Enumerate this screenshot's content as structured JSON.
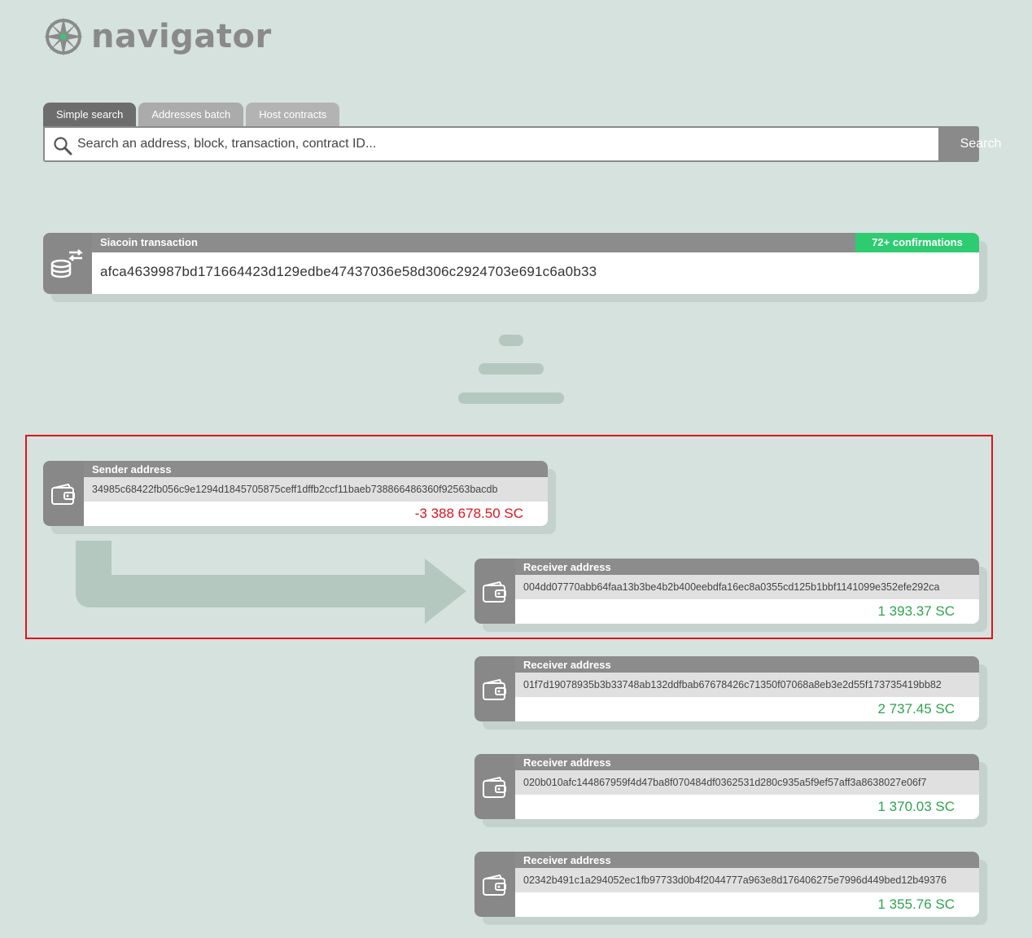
{
  "brand": {
    "name": "navigator"
  },
  "tabs": [
    {
      "label": "Simple search",
      "active": true
    },
    {
      "label": "Addresses batch",
      "active": false
    },
    {
      "label": "Host contracts",
      "active": false
    }
  ],
  "search": {
    "placeholder": "Search an address, block, transaction, contract ID...",
    "value": "",
    "button_label": "Search",
    "icon": "search-icon"
  },
  "transaction": {
    "type_label": "Siacoin transaction",
    "confirmations": "72+ confirmations",
    "hash": "afca4639987bd171664423d129edbe47437036e58d306c2924703e691c6a0b33",
    "icon": "coins-exchange-icon"
  },
  "sender": {
    "title": "Sender address",
    "address": "34985c68422fb056c9e1294d1845705875ceff1dffb2ccf11baeb738866486360f92563bacdb",
    "amount": "-3 388 678.50 SC",
    "icon": "wallet-icon"
  },
  "receivers": [
    {
      "title": "Receiver address",
      "address": "004dd07770abb64faa13b3be4b2b400eebdfa16ec8a0355cd125b1bbf1141099e352efe292ca",
      "amount": "1 393.37 SC"
    },
    {
      "title": "Receiver address",
      "address": "01f7d19078935b3b33748ab132ddfbab67678426c71350f07068a8eb3e2d55f173735419bb82",
      "amount": "2 737.45 SC"
    },
    {
      "title": "Receiver address",
      "address": "020b010afc144867959f4d47ba8f070484df0362531d280c935a5f9ef57aff3a8638027e06f7",
      "amount": "1 370.03 SC"
    },
    {
      "title": "Receiver address",
      "address": "02342b491c1a294052ec1fb97733d0b4f2044777a963e8d176406275e7996d449bed12b49376",
      "amount": "1 355.76 SC"
    }
  ],
  "colors": {
    "background": "#d5e2de",
    "card_header": "#8c8c8c",
    "confirmations": "#2ecc71",
    "negative": "#e0141e",
    "positive": "#2ea44f",
    "highlight_border": "#e0141e"
  }
}
